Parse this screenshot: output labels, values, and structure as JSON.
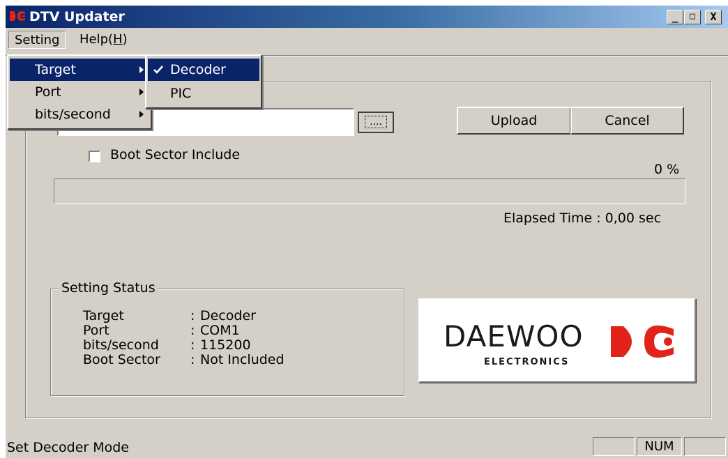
{
  "window": {
    "title": "DTV Updater",
    "minimize_glyph": "_",
    "maximize_glyph": "□",
    "close_glyph": "X"
  },
  "menubar": {
    "setting": "Setting",
    "help": "Help(H)"
  },
  "setting_menu": {
    "items": [
      {
        "label": "Target"
      },
      {
        "label": "Port"
      },
      {
        "label": "bits/second"
      }
    ]
  },
  "target_submenu": {
    "items": [
      {
        "label": "Decoder",
        "checked": true
      },
      {
        "label": "PIC",
        "checked": false
      }
    ]
  },
  "file_select": {
    "path": "",
    "browse_label": "...."
  },
  "buttons": {
    "upload": "Upload",
    "cancel": "Cancel"
  },
  "boot_sector": {
    "label": "Boot Sector Include",
    "checked": false
  },
  "progress": {
    "percent_text": "0 %",
    "value": 0
  },
  "elapsed": {
    "text": "Elapsed Time : 0,00 sec"
  },
  "setting_status": {
    "title": "Setting Status",
    "rows": [
      {
        "key": "Target",
        "sep": ":",
        "value": "Decoder"
      },
      {
        "key": "Port",
        "sep": ":",
        "value": "COM1"
      },
      {
        "key": "bits/second",
        "sep": ":",
        "value": "115200"
      },
      {
        "key": "Boot Sector",
        "sep": ":",
        "value": "Not Included"
      }
    ]
  },
  "logo": {
    "brand": "DAEWOO",
    "sub": "ELECTRONICS",
    "color": "#e2231a"
  },
  "statusbar": {
    "message": "Set Decoder Mode",
    "num": "NUM"
  }
}
